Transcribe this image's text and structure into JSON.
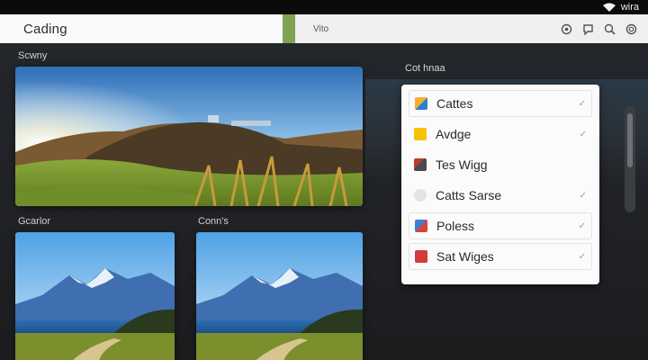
{
  "status": {
    "carrier": "wira"
  },
  "header": {
    "title": "Cading",
    "view_label": "Vito",
    "icons": [
      "settings-icon",
      "chat-icon",
      "search-icon",
      "refresh-icon"
    ]
  },
  "main": {
    "hero_section_label": "Scwny",
    "left_section_label": "Gcarlor",
    "right_section_label": "Conn's"
  },
  "panel": {
    "title": "Cot hnaa",
    "items": [
      {
        "label": "Cattes",
        "icon": "palette-icon",
        "color": "#f2b134",
        "check": "✓",
        "boxed": true
      },
      {
        "label": "Avdge",
        "icon": "yellow-square-icon",
        "color": "#f5c400",
        "check": "✓",
        "boxed": false
      },
      {
        "label": "Tes Wigg",
        "icon": "photo-icon",
        "color": "#c0392b",
        "check": "",
        "boxed": false
      },
      {
        "label": "Catts Sarse",
        "icon": "circle-icon",
        "color": "#e4e4e4",
        "check": "✓",
        "boxed": false
      },
      {
        "label": "Poless",
        "icon": "image-icon",
        "color": "#3f7fd1",
        "check": "✓",
        "boxed": true
      },
      {
        "label": "Sat Wiges",
        "icon": "red-square-icon",
        "color": "#d33a3a",
        "check": "✓",
        "boxed": true
      }
    ]
  }
}
